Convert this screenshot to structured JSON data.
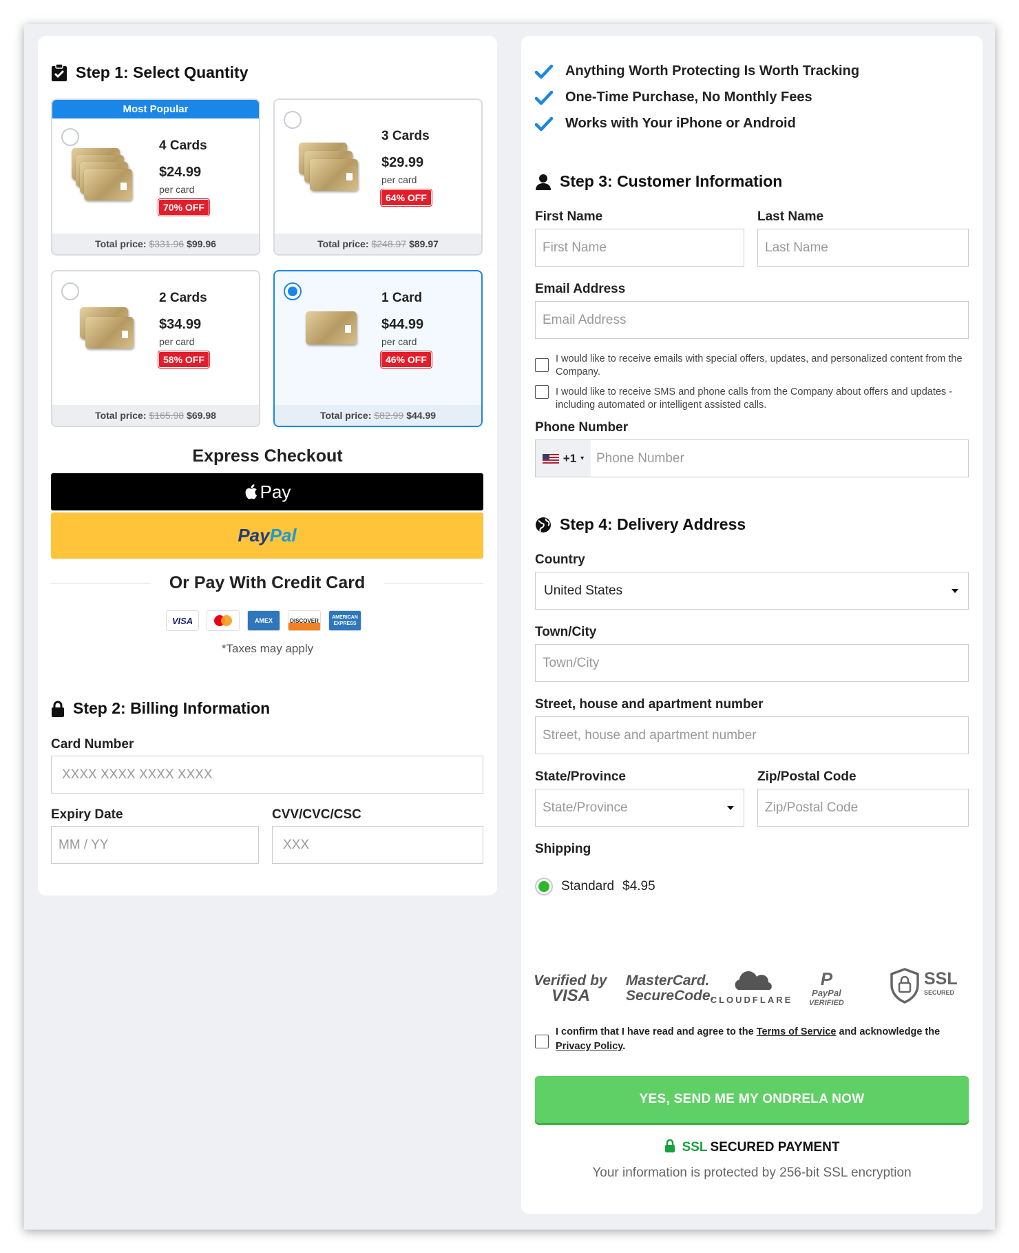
{
  "step1": {
    "title": "Step 1: Select Quantity",
    "options": [
      {
        "popular_label": "Most Popular",
        "qty": "4 Cards",
        "price": "$24.99",
        "per": "per card",
        "off": "70% OFF",
        "total_label": "Total price:",
        "old_total": "$331.96",
        "total": "$99.96",
        "selected": false
      },
      {
        "qty": "3 Cards",
        "price": "$29.99",
        "per": "per card",
        "off": "64% OFF",
        "total_label": "Total price:",
        "old_total": "$248.97",
        "total": "$89.97",
        "selected": false
      },
      {
        "qty": "2 Cards",
        "price": "$34.99",
        "per": "per card",
        "off": "58% OFF",
        "total_label": "Total price:",
        "old_total": "$165.98",
        "total": "$69.98",
        "selected": false
      },
      {
        "qty": "1 Card",
        "price": "$44.99",
        "per": "per card",
        "off": "46% OFF",
        "total_label": "Total price:",
        "old_total": "$82.99",
        "total": "$44.99",
        "selected": true
      }
    ]
  },
  "express": {
    "title": "Express Checkout",
    "applepay_label": "Pay",
    "paypal_a": "Pay",
    "paypal_b": "Pal",
    "or_pay": "Or Pay With Credit Card",
    "card_logos": [
      "VISA",
      "mastercard",
      "AMEX",
      "DISCOVER",
      "AMERICAN EXPRESS"
    ],
    "taxes": "*Taxes may apply"
  },
  "step2": {
    "title": "Step 2: Billing Information",
    "card_number_label": "Card Number",
    "card_number_placeholder": "XXXX XXXX XXXX XXXX",
    "expiry_label": "Expiry Date",
    "expiry_placeholder": "MM / YY",
    "cvv_label": "CVV/CVC/CSC",
    "cvv_placeholder": "XXX"
  },
  "features": [
    "Anything Worth Protecting Is Worth Tracking",
    "One-Time Purchase, No Monthly Fees",
    "Works with Your iPhone or Android"
  ],
  "step3": {
    "title": "Step 3: Customer Information",
    "first_label": "First Name",
    "first_placeholder": "First Name",
    "last_label": "Last Name",
    "last_placeholder": "Last Name",
    "email_label": "Email Address",
    "email_placeholder": "Email Address",
    "consent_email": "I would like to receive emails with special offers, updates, and personalized content from the Company.",
    "consent_sms": "I would like to receive SMS and phone calls from the Company about offers and updates - including automated or intelligent assisted calls.",
    "phone_label": "Phone Number",
    "phone_code": "+1",
    "phone_placeholder": "Phone Number"
  },
  "step4": {
    "title": "Step 4: Delivery Address",
    "country_label": "Country",
    "country_value": "United States",
    "city_label": "Town/City",
    "city_placeholder": "Town/City",
    "street_label": "Street, house and apartment number",
    "street_placeholder": "Street, house and apartment number",
    "state_label": "State/Province",
    "state_placeholder": "State/Province",
    "zip_label": "Zip/Postal Code",
    "zip_placeholder": "Zip/Postal Code",
    "shipping_label": "Shipping",
    "shipping_option": "Standard",
    "shipping_price": "$4.95"
  },
  "badges": {
    "verified": "Verified by",
    "visa": "VISA",
    "mc1": "MasterCard.",
    "mc2": "SecureCode.",
    "cloudflare": "CLOUDFLARE",
    "paypal1": "PayPal",
    "paypal2": "VERIFIED",
    "ssl": "SSL",
    "ssl_sub": "SECURED"
  },
  "terms": {
    "pre": "I confirm that I have read and agree to the ",
    "tos": "Terms of Service",
    "mid": " and acknowledge the ",
    "privacy": "Privacy Policy",
    "end": "."
  },
  "submit_label": "YES, SEND ME MY ONDRELA NOW",
  "secured": {
    "ssl": "SSL",
    "rest": "SECURED PAYMENT"
  },
  "protected_text": "Your information is protected by 256-bit SSL encryption",
  "colors": {
    "accent": "#1a86e8",
    "discount": "#e31e2b",
    "submit": "#5fd065",
    "paypal": "#ffc439"
  }
}
